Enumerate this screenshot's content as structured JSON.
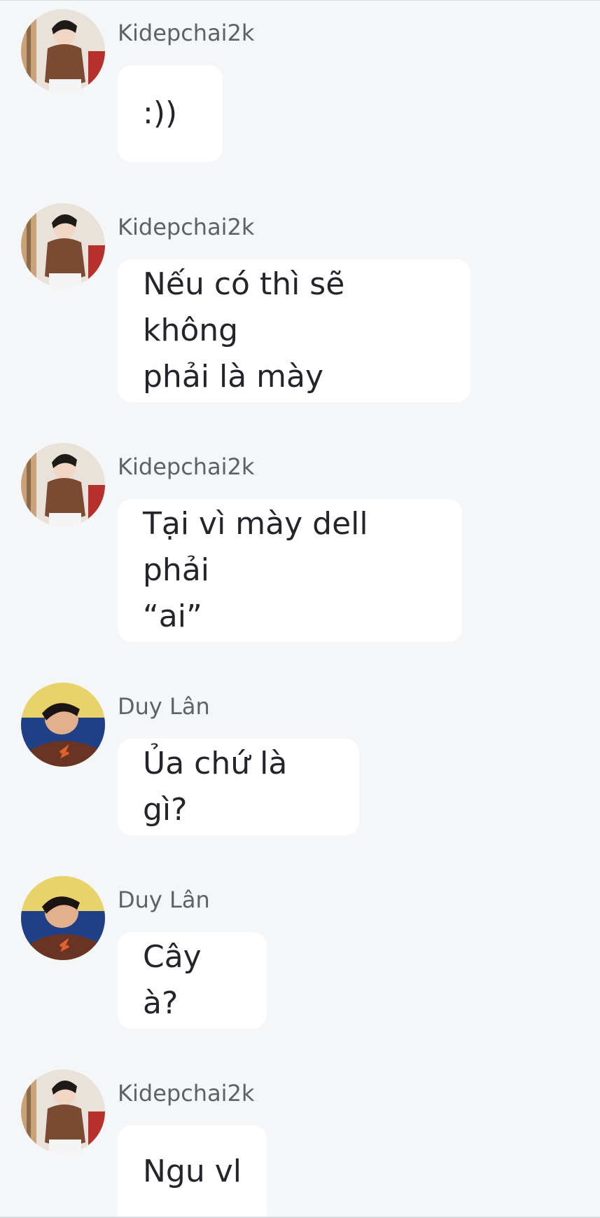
{
  "messages": [
    {
      "sender": "Kidepchai2k",
      "text": ":))",
      "avatar": "kidepchai-avatar"
    },
    {
      "sender": "Kidepchai2k",
      "text": "Nếu có thì sẽ không\nphải là mày",
      "avatar": "kidepchai-avatar"
    },
    {
      "sender": "Kidepchai2k",
      "text": "Tại vì mày dell phải\n“ai”",
      "avatar": "kidepchai-avatar"
    },
    {
      "sender": "Duy Lân",
      "text": "Ủa chứ là gì?",
      "avatar": "duylan-avatar"
    },
    {
      "sender": "Duy Lân",
      "text": "Cây à?",
      "avatar": "duylan-avatar"
    },
    {
      "sender": "Kidepchai2k",
      "text": "Ngu vl",
      "avatar": "kidepchai-avatar"
    }
  ],
  "colors": {
    "background": "#f5f6f8",
    "bubble": "#ffffff",
    "sender_text": "#5d6168",
    "message_text": "#23252a"
  }
}
